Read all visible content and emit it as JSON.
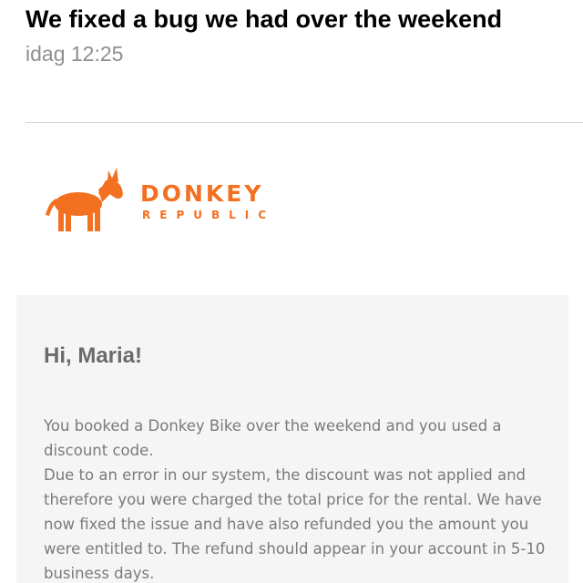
{
  "email": {
    "subject": "We fixed a bug we had over the weekend",
    "date": "idag 12:25"
  },
  "logo": {
    "icon": "donkey-icon",
    "word1": "DONKEY",
    "word2": "REPUBLIC",
    "color": "#f37021"
  },
  "message": {
    "greeting": "Hi, Maria!",
    "paragraph1": "You booked a Donkey Bike over the weekend and you used a discount code.",
    "paragraph2": "Due to an error in our system, the discount was not applied and therefore you were charged the total price for the rental. We have now fixed the issue and have also refunded you the amount you were entitled to. The refund should appear in your account in 5-10 business days."
  }
}
